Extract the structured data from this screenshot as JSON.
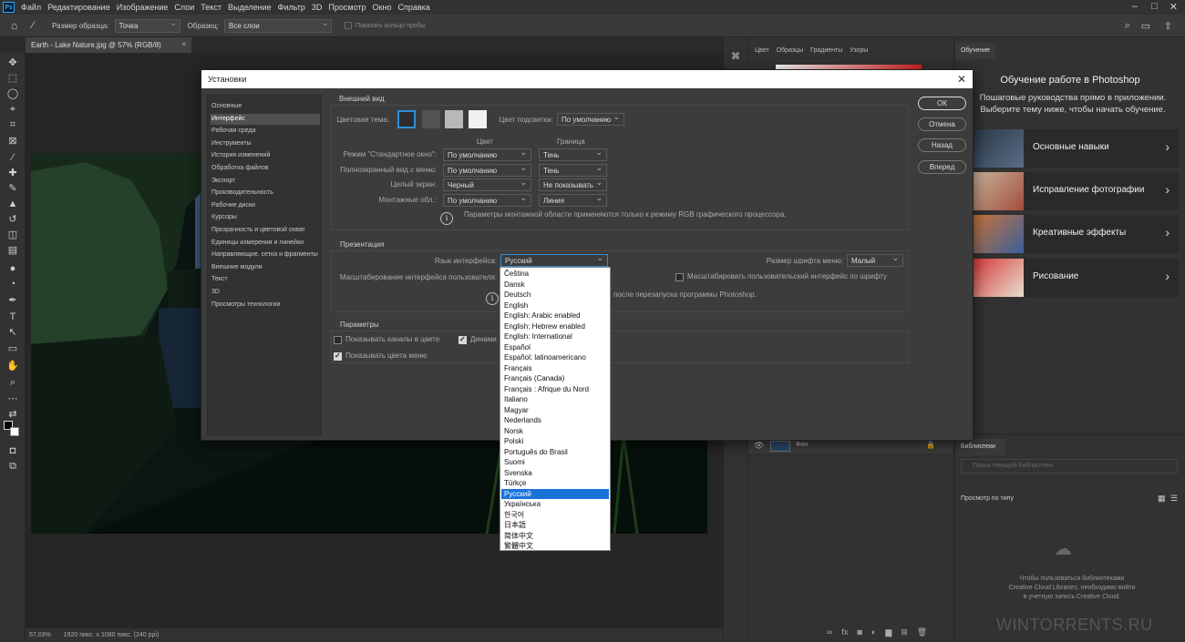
{
  "menu": [
    "Файл",
    "Редактирование",
    "Изображение",
    "Слои",
    "Текст",
    "Выделение",
    "Фильтр",
    "3D",
    "Просмотр",
    "Окно",
    "Справка"
  ],
  "options": {
    "sample_size_label": "Размер образца:",
    "sample_size_value": "Точка",
    "sample_label": "Образец:",
    "sample_value": "Все слои",
    "show_ring": "Показать кольцо пробы"
  },
  "document_tab": "Earth - Lake Nature.jpg @ 57% (RGB/8)",
  "status": {
    "zoom": "57,03%",
    "info": "1920 пикс. x 1080 пикс. (240 ppi)"
  },
  "color_panel_tabs": [
    "Цвет",
    "Образцы",
    "Градиенты",
    "Узоры"
  ],
  "learn_panel": {
    "tab": "Обучение",
    "title": "Обучение работе в Photoshop",
    "subtitle": "Пошаговые руководства прямо в приложении. Выберите тему ниже, чтобы начать обучение.",
    "items": [
      "Основные навыки",
      "Исправление фотографии",
      "Креативные эффекты",
      "Рисование"
    ]
  },
  "layers": {
    "layer_name": "Фон"
  },
  "libraries": {
    "tab": "Библиотеки",
    "search_placeholder": "Поиск текущей библиотеки",
    "view_by": "Просмотр по типу",
    "message": "Чтобы пользоваться библиотеками Creative Cloud Libraries, необходимо войти в учетную запись Creative Cloud."
  },
  "watermark": "WINTORRENTS.RU",
  "dialog": {
    "title": "Установки",
    "categories": [
      "Основные",
      "Интерфейс",
      "Рабочая среда",
      "Инструменты",
      "История изменений",
      "Обработка файлов",
      "Экспорт",
      "Производительность",
      "Рабочие диски",
      "Курсоры",
      "Прозрачность и цветовой охват",
      "Единицы измерения и линейки",
      "Направляющие, сетка и фрагменты",
      "Внешние модули",
      "Текст",
      "3D",
      "Просмотры технологии"
    ],
    "buttons": [
      "ОК",
      "Отмена",
      "Назад",
      "Вперед"
    ],
    "appearance": {
      "header": "Внешний вид",
      "color_theme": "Цветовая тема:",
      "highlight_label": "Цвет подсветки:",
      "highlight_value": "По умолчанию",
      "col_color": "Цвет",
      "col_border": "Граница",
      "rows": [
        {
          "label": "Режим \"Стандартное окно\":",
          "color": "По умолчанию",
          "border": "Тень"
        },
        {
          "label": "Полноэкранный вид с меню:",
          "color": "По умолчанию",
          "border": "Тень"
        },
        {
          "label": "Целый экран:",
          "color": "Черный",
          "border": "Не показывать"
        },
        {
          "label": "Монтажные обл.:",
          "color": "По умолчанию",
          "border": "Линия"
        }
      ],
      "note": "Параметры монтажной области применяются только к режиму RGB графического процессора."
    },
    "presentation": {
      "header": "Презентация",
      "lang_label": "Язык интерфейса:",
      "lang_value": "Русский",
      "fontsize_label": "Размер шрифта меню:",
      "fontsize_value": "Малый",
      "scale_label": "Масштабирование интерфейса пользователя:",
      "scale_font": "Масштабировать пользовательский интерфейс по шрифту",
      "note": "после перезапуска программы Photoshop."
    },
    "params": {
      "header": "Параметры",
      "show_channels": "Показывать каналы в цвете",
      "dynamic": "Динами",
      "show_menu_colors": "Показывать цвета меню"
    }
  },
  "languages": [
    "Čeština",
    "Dansk",
    "Deutsch",
    "English",
    "English: Arabic enabled",
    "English: Hebrew enabled",
    "English: International",
    "Español",
    "Español: latinoamericano",
    "Français",
    "Français (Canada)",
    "Français : Afrique du Nord",
    "Italiano",
    "Magyar",
    "Nederlands",
    "Norsk",
    "Polski",
    "Português do Brasil",
    "Suomi",
    "Svenska",
    "Türkçe",
    "Русский",
    "Українська",
    "한국어",
    "日本語",
    "简体中文",
    "繁體中文"
  ],
  "selected_language": "Русский"
}
